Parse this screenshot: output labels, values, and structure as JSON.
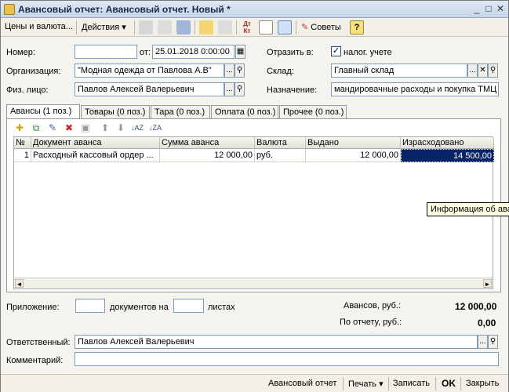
{
  "window": {
    "title": "Авансовый отчет: Авансовый отчет. Новый *"
  },
  "toolbar": {
    "prices_label": "Цены и валюта...",
    "actions_label": "Действия",
    "tips_label": "Советы",
    "help_label": "?",
    "dt_kt_label": "Дт Кт"
  },
  "form": {
    "number_label": "Номер:",
    "number_value": "",
    "date_from_label": "от:",
    "date_value": "25.01.2018  0:00:00",
    "reflect_label": "Отразить в:",
    "tax_label": "налог. учете",
    "org_label": "Организация:",
    "org_value": "\"Модная одежда от Павлова А.В\"",
    "warehouse_label": "Склад:",
    "warehouse_value": "Главный склад",
    "person_label": "Физ. лицо:",
    "person_value": "Павлов Алексей Валерьевич",
    "purpose_label": "Назначение:",
    "purpose_value": "мандировачные расходы и покупка ТМЦ"
  },
  "tabs": [
    {
      "label": "Авансы (1 поз.)"
    },
    {
      "label": "Товары (0 поз.)"
    },
    {
      "label": "Тара (0 поз.)"
    },
    {
      "label": "Оплата (0 поз.)"
    },
    {
      "label": "Прочее (0 поз.)"
    }
  ],
  "grid": {
    "columns": [
      "№",
      "Документ аванса",
      "Сумма аванса",
      "Валюта",
      "Выдано",
      "Израсходовано"
    ],
    "rows": [
      {
        "n": "1",
        "doc": "Расходный кассовый ордер ...",
        "sum": "12 000,00",
        "currency": "руб.",
        "issued": "12 000,00",
        "spent": "14 500,00"
      }
    ]
  },
  "tooltip": {
    "text": "Информация об авансе"
  },
  "footer": {
    "attachment_label": "Приложение:",
    "attachment_docs": "",
    "docs_on_label": "документов на",
    "sheets_value": "",
    "sheets_label": "листах",
    "advances_label": "Авансов, руб.:",
    "advances_value": "12 000,00",
    "report_label": "По отчету, руб.:",
    "report_value": "0,00",
    "responsible_label": "Ответственный:",
    "responsible_value": "Павлов Алексей Валерьевич",
    "comment_label": "Комментарий:",
    "comment_value": ""
  },
  "bottombar": {
    "report_btn": "Авансовый отчет",
    "print_btn": "Печать",
    "save_btn": "Записать",
    "ok_btn": "OK",
    "close_btn": "Закрыть"
  }
}
